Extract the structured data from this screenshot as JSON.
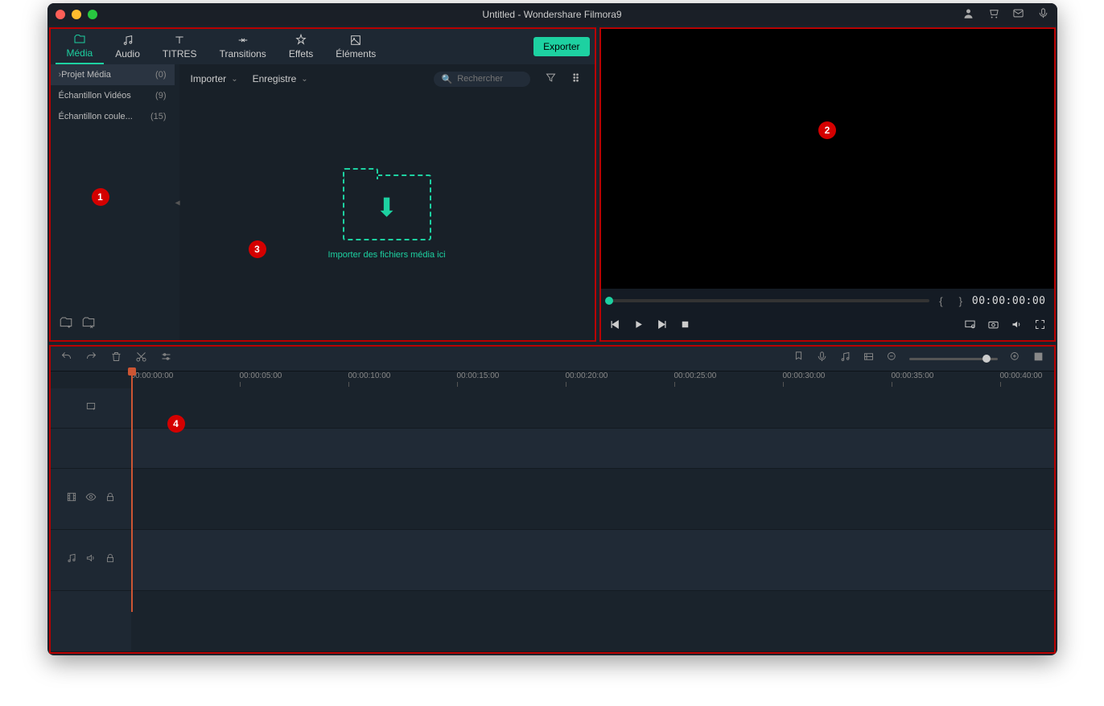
{
  "titlebar": {
    "title": "Untitled - Wondershare Filmora9"
  },
  "tabs": [
    {
      "label": "Média"
    },
    {
      "label": "Audio"
    },
    {
      "label": "TITRES"
    },
    {
      "label": "Transitions"
    },
    {
      "label": "Effets"
    },
    {
      "label": "Éléments"
    }
  ],
  "export_label": "Exporter",
  "sidebar": {
    "items": [
      {
        "label": "Projet Média",
        "count": "(0)"
      },
      {
        "label": "Échantillon Vidéos",
        "count": "(9)"
      },
      {
        "label": "Échantillon coule...",
        "count": "(15)"
      }
    ]
  },
  "content_header": {
    "import_label": "Importer",
    "record_label": "Enregistre",
    "search_placeholder": "Rechercher"
  },
  "dropzone_text": "Importer des fichiers média ici",
  "preview": {
    "timecode": "00:00:00:00"
  },
  "ruler_ticks": [
    "00:00:00:00",
    "00:00:05:00",
    "00:00:10:00",
    "00:00:15:00",
    "00:00:20:00",
    "00:00:25:00",
    "00:00:30:00",
    "00:00:35:00",
    "00:00:40:00"
  ],
  "badges": {
    "b1": "1",
    "b2": "2",
    "b3": "3",
    "b4": "4"
  }
}
